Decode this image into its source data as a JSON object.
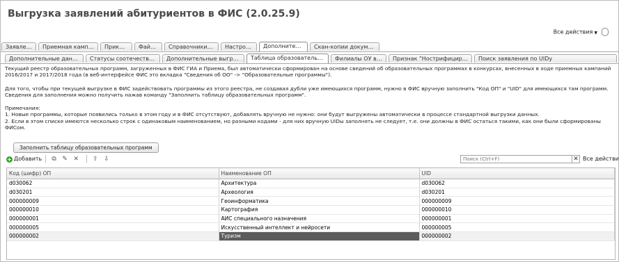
{
  "window": {
    "title": "Выгрузка заявлений абитуриентов в ФИС (2.0.25.9)",
    "all_actions": "Все действия"
  },
  "tabs_main": [
    "Заявления",
    "Приемная кампания",
    "Приказы",
    "Файлы",
    "Справочники ФИС",
    "Настройки",
    "Дополнительно",
    "Скан-копии документов"
  ],
  "tabs_main_active": "Дополнительно",
  "tabs_sub": [
    "Дополнительные данные п...",
    "Статусы соотечественников",
    "Дополнительные выгружае...",
    "Таблица образовательных ...",
    "Филиалы ОУ в ФИС",
    "Признак \"Нострифицирова...",
    "Поиск заявления по UIDу"
  ],
  "tabs_sub_active": "Таблица образовательных ...",
  "description": {
    "p1": "Текущий реестр образовательных программ, загруженных в ФИС ГИА и Приема, был автоматически сформирован на основе сведений об образовательных программах в конкурсах, внесенных в ходе приемных кампаний 2016/2017 и 2017/2018 года (в веб-интерфейсе ФИС это вкладка \"Сведения об ОО\" -> \"Образовательные программы\").",
    "p2": "Для того, чтобы при текущей выгрузке в ФИС задействовать программы из этого реестра, не создавая дубли уже имеющихся программ, нужно в ФИС вручную заполнить \"Код ОП\" и \"UID\" для имеющихся там программ. Сведения для заполнения можно получить нажав команду \"Заполнить таблицу образовательных программ\".",
    "notes_title": "Примечания:",
    "note1": "1. Новые программы, которые появились только в этом году и в ФИС отсутствуют, добавлять вручную не нужно: они будут выгружены автоматически в процессе стандартной выгрузки данных.",
    "note2": "2. Если в этом списке имеются несколько строк с одинаковым наименованием, но разными кодами - для них вручную UIDы заполнять не следует, т.е. они должны в ФИС остаться такими, как они были сформированы ФИСом."
  },
  "fill_button": "Заполнить таблицу образовательных программ",
  "toolbar": {
    "add": "Добавить",
    "search_placeholder": "Поиск (Ctrl+F)",
    "all_actions": "Все действия"
  },
  "table": {
    "columns": [
      "Код (шифр) ОП",
      "Наименование ОП",
      "UID"
    ],
    "rows": [
      [
        "d030062",
        "Архитектура",
        "d030062"
      ],
      [
        "d030201",
        "Археология",
        "d030201"
      ],
      [
        "000000009",
        "Геоинформатика",
        "000000009"
      ],
      [
        "000000010",
        "Картография",
        "000000010"
      ],
      [
        "000000001",
        "АИС специального назначения",
        "000000001"
      ],
      [
        "000000005",
        "Искусственный интеллект и нейросети",
        "000000005"
      ],
      [
        "000000002",
        "Туризм",
        "000000002"
      ]
    ],
    "selected_row": 6
  }
}
